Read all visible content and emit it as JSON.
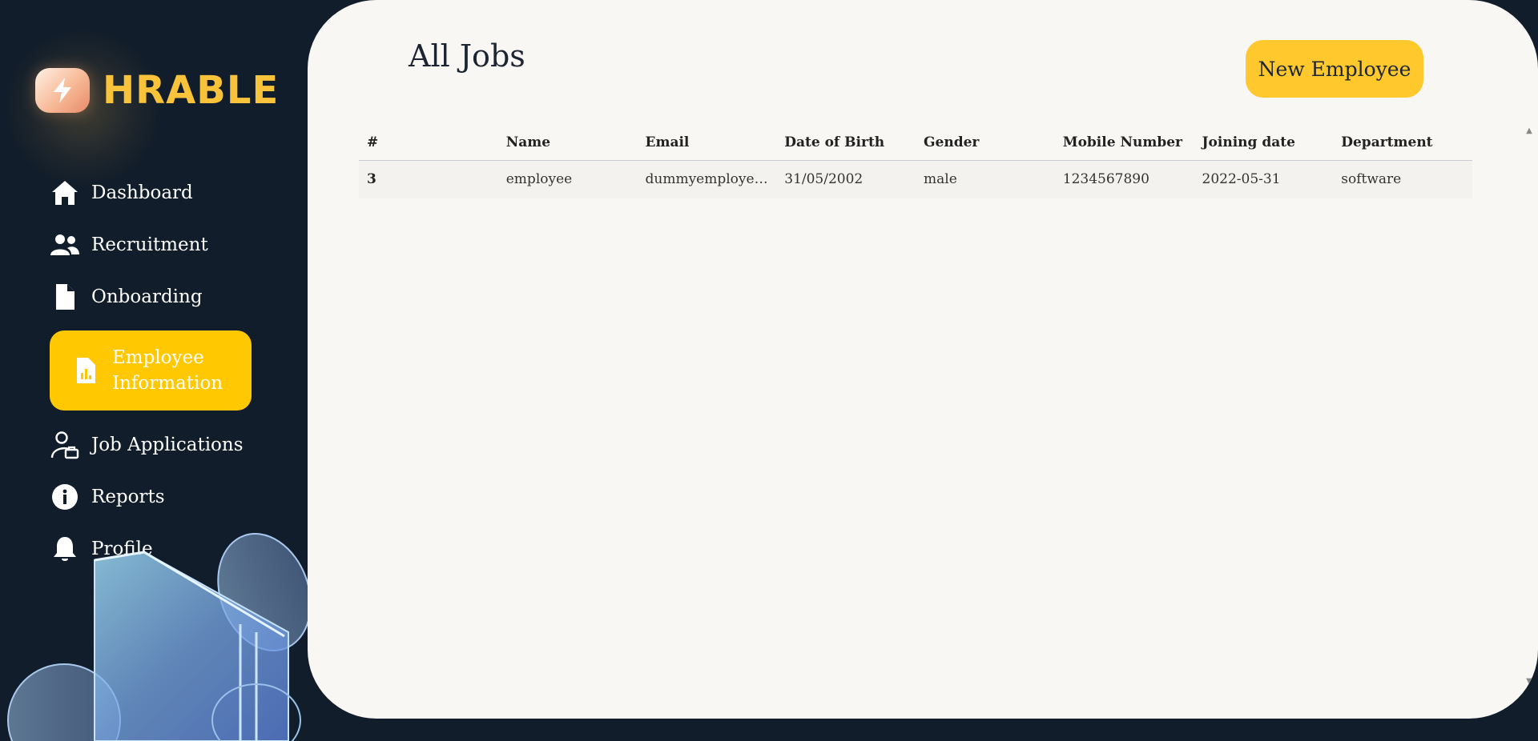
{
  "brand": {
    "name": "HRABLE"
  },
  "sidebar": {
    "items": [
      {
        "label": "Dashboard",
        "icon": "home-icon",
        "active": false
      },
      {
        "label": "Recruitment",
        "icon": "users-icon",
        "active": false
      },
      {
        "label": "Onboarding",
        "icon": "file-icon",
        "active": false
      },
      {
        "label": "Employee Information",
        "icon": "report-file-icon",
        "active": true
      },
      {
        "label": "Job Applications",
        "icon": "user-briefcase-icon",
        "active": false
      },
      {
        "label": "Reports",
        "icon": "info-icon",
        "active": false
      },
      {
        "label": "Profile",
        "icon": "bell-icon",
        "active": false
      }
    ]
  },
  "main": {
    "title": "All Jobs",
    "new_button": "New Employee",
    "table": {
      "columns": [
        "#",
        "Name",
        "Email",
        "Date of Birth",
        "Gender",
        "Mobile Number",
        "Joining date",
        "Department"
      ],
      "rows": [
        [
          "3",
          "employee",
          "dummyemployee@gmail.com",
          "31/05/2002",
          "male",
          "1234567890",
          "2022-05-31",
          "software"
        ]
      ]
    }
  },
  "colors": {
    "sidebar_bg": "#111d2a",
    "accent": "#ffc800",
    "brand_text": "#f8c33a",
    "panel_bg": "#f8f7f3"
  }
}
